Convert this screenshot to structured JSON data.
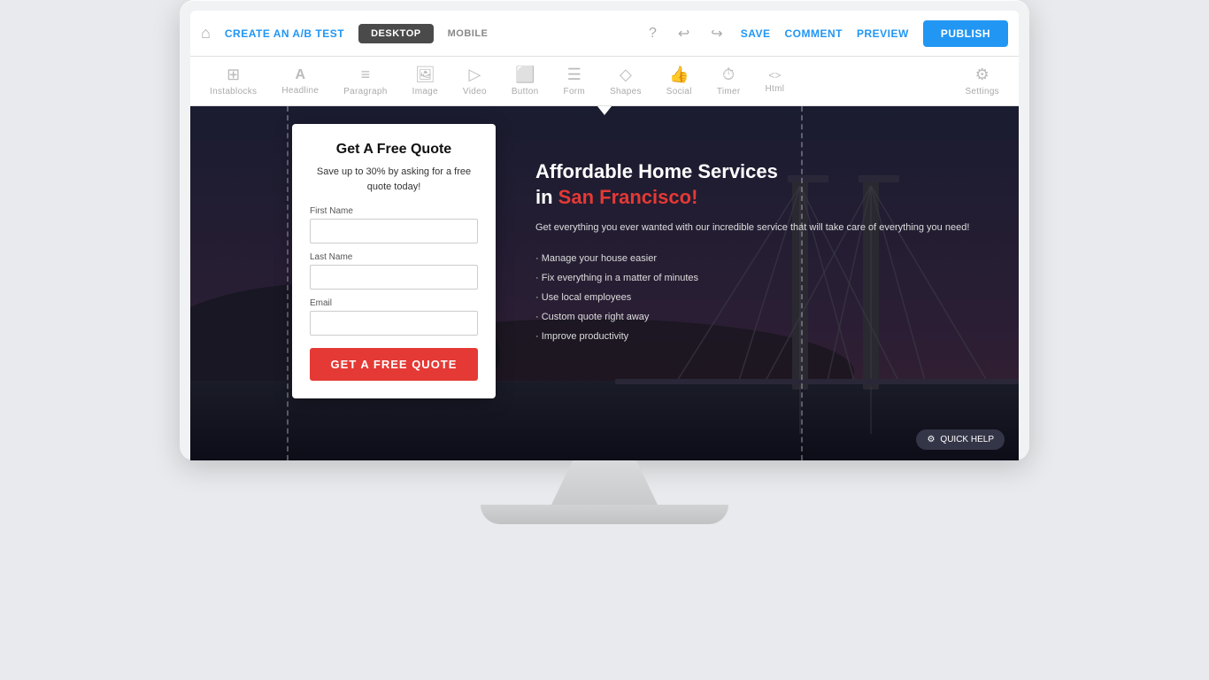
{
  "toolbar": {
    "home_icon": "⌂",
    "ab_test_label": "CREATE AN A/B TEST",
    "desktop_label": "DESKTOP",
    "mobile_label": "MOBILE",
    "undo_icon": "↩",
    "redo_icon": "↪",
    "help_icon": "?",
    "save_label": "SAVE",
    "comment_label": "COMMENT",
    "preview_label": "PREVIEW",
    "publish_label": "PUBLISH"
  },
  "secondary_toolbar": {
    "tools": [
      {
        "icon": "⊞",
        "label": "Instablocks"
      },
      {
        "icon": "T",
        "label": "Headline"
      },
      {
        "icon": "≡",
        "label": "Paragraph"
      },
      {
        "icon": "🖼",
        "label": "Image"
      },
      {
        "icon": "▷",
        "label": "Video"
      },
      {
        "icon": "⬜",
        "label": "Button"
      },
      {
        "icon": "☰",
        "label": "Form"
      },
      {
        "icon": "◇",
        "label": "Shapes"
      },
      {
        "icon": "👍",
        "label": "Social"
      },
      {
        "icon": "⏱",
        "label": "Timer"
      },
      {
        "icon": "<>",
        "label": "Html"
      }
    ],
    "settings_label": "Settings",
    "settings_icon": "⚙"
  },
  "form_card": {
    "title": "Get A Free Quote",
    "subtitle": "Save up to 30% by asking for a free quote today!",
    "first_name_label": "First Name",
    "last_name_label": "Last Name",
    "email_label": "Email",
    "submit_label": "GET A FREE QUOTE"
  },
  "right_content": {
    "heading_line1": "Affordable Home Services",
    "heading_line2": "in ",
    "heading_accent": "San Francisco!",
    "description": "Get everything you ever wanted with our incredible service that will take care of everything you need!",
    "bullets": [
      "Manage your house easier",
      "Fix everything in a matter of minutes",
      "Use local employees",
      "Custom quote right away",
      "Improve productivity"
    ]
  },
  "quick_help": {
    "icon": "⚙",
    "label": "QUICK HELP"
  },
  "colors": {
    "accent_blue": "#2196F3",
    "accent_red": "#e53935",
    "toolbar_bg": "#ffffff",
    "canvas_bg": "#1a1c2e"
  }
}
